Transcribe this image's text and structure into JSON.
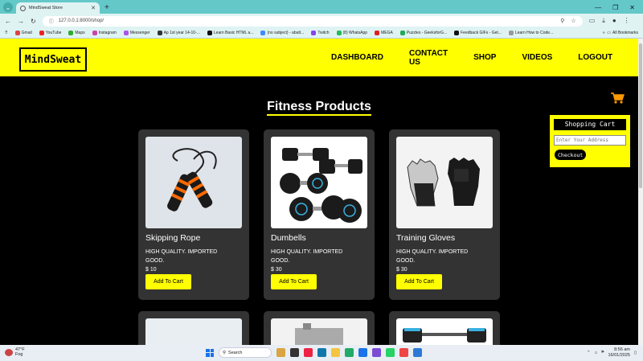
{
  "browser": {
    "tab_title": "MindSweat Store",
    "url": "127.0.0.1:8000/shop/",
    "bookmarks": [
      "Gmail",
      "YouTube",
      "Maps",
      "Instagram",
      "Messenger",
      "Ap 1st year 14-10-...",
      "Learn Basic HTML a...",
      "(no subject) - abutt...",
      "Twitch",
      "(8) WhatsApp",
      "MEGA",
      "Puzzles - GeeksforG...",
      "Feedback GIFs - Get...",
      "Learn How to Code..."
    ],
    "all_bookmarks": "All Bookmarks"
  },
  "site": {
    "logo": "MindSweat",
    "nav": [
      "DASHBOARD",
      "CONTACT US",
      "SHOP",
      "VIDEOS",
      "LOGOUT"
    ],
    "page_title": "Fitness Products",
    "cart": {
      "title": "Shopping Cart",
      "address_placeholder": "Enter Your Address",
      "checkout_label": "Checkout"
    },
    "products": [
      {
        "name": "Skipping Rope",
        "description": "HIGH QUALITY. IMPORTED GOOD.",
        "price": "$ 10",
        "button": "Add To Cart"
      },
      {
        "name": "Dumbells",
        "description": "HIGH QUALITY. IMPORTED GOOD.",
        "price": "$ 30",
        "button": "Add To Cart"
      },
      {
        "name": "Training Gloves",
        "description": "HIGH QUALITY. IMPORTED GOOD.",
        "price": "$ 30",
        "button": "Add To Cart"
      }
    ]
  },
  "taskbar": {
    "weather_temp": "47°F",
    "weather_desc": "Fog",
    "search_label": "Search",
    "time": "8:56 am",
    "date": "16/01/2025"
  },
  "colors": {
    "accent": "#ffff00",
    "background": "#000000",
    "card": "#333333",
    "chrome": "#64c8c8"
  }
}
